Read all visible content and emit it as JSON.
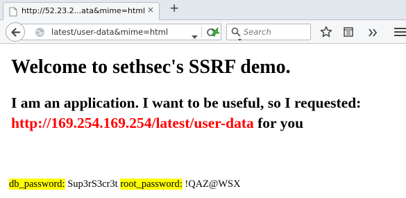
{
  "browser": {
    "tab": {
      "title": "http://52.23.2...ata&mime=html",
      "close_glyph": "×"
    },
    "new_tab_glyph": "+",
    "address_bar": {
      "url": "latest/user-data&mime=html"
    },
    "search": {
      "placeholder": "Search"
    },
    "icons": [
      "globe-icon",
      "back-arrow-icon",
      "dropdown-arrow-icon",
      "reload-icon",
      "addon-icon",
      "search-icon",
      "bookmark-star-icon",
      "reading-list-icon",
      "overflow-chevrons-icon",
      "hamburger-menu-icon"
    ],
    "colors": {
      "tabstrip": "#e3e8ee",
      "toolbar": "#f5f6f7",
      "addon_green": "#3cb043"
    }
  },
  "page": {
    "heading": "Welcome to sethsec's SSRF demo.",
    "intro_text": "I am an application. I want to be useful, so I requested:",
    "requested_url": "http://169.254.169.254/latest/user-data",
    "intro_suffix": " for you",
    "credentials": {
      "db_label": "db_password:",
      "db_value": " Sup3rS3cr3t ",
      "root_label": "root_password:",
      "root_value": " !QAZ@WSX"
    },
    "colors": {
      "url_red": "#ff0000",
      "highlight_yellow": "#ffff00"
    }
  }
}
